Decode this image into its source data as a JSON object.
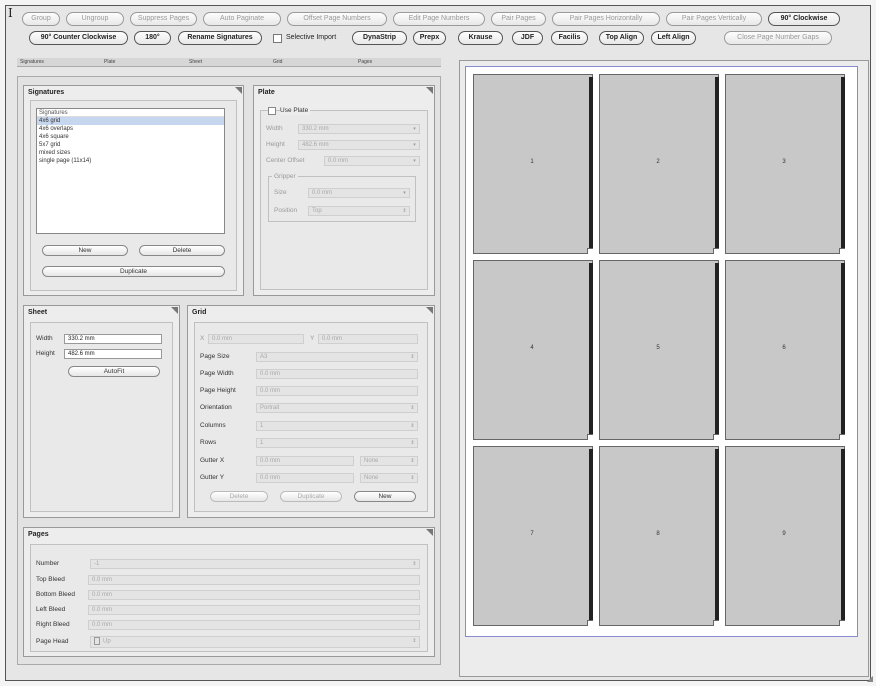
{
  "toolbar": {
    "row1": [
      {
        "label": "Group",
        "enabled": false
      },
      {
        "label": "Ungroup",
        "enabled": false
      },
      {
        "label": "Suppress Pages",
        "enabled": false
      },
      {
        "label": "Auto Paginate",
        "enabled": false
      },
      {
        "label": "Offset Page Numbers",
        "enabled": false
      },
      {
        "label": "Edit Page Numbers",
        "enabled": false
      },
      {
        "label": "Pair Pages",
        "enabled": false
      },
      {
        "label": "Pair Pages Horizontally",
        "enabled": false
      },
      {
        "label": "Pair Pages Vertically",
        "enabled": false
      },
      {
        "label": "90° Clockwise",
        "enabled": true
      }
    ],
    "row2": [
      {
        "label": "90° Counter Clockwise",
        "enabled": true
      },
      {
        "label": "180°",
        "enabled": true
      },
      {
        "label": "Rename Signatures",
        "enabled": true
      },
      {
        "label": "DynaStrip",
        "enabled": true
      },
      {
        "label": "Prepx",
        "enabled": true
      },
      {
        "label": "Krause",
        "enabled": true
      },
      {
        "label": "JDF",
        "enabled": true
      },
      {
        "label": "Facilis",
        "enabled": true
      },
      {
        "label": "Top Align",
        "enabled": true
      },
      {
        "label": "Left Align",
        "enabled": true
      },
      {
        "label": "Close Page Number Gaps",
        "enabled": false
      }
    ],
    "selective_import": "Selective Import"
  },
  "columns": [
    "Signatures",
    "Plate",
    "Sheet",
    "Grid",
    "Pages"
  ],
  "signatures": {
    "title": "Signatures",
    "list_header": "Signatures",
    "items": [
      "4x6 grid",
      "4x6 overlaps",
      "4x6 square",
      "5x7 grid",
      "mixed sizes",
      "single page (11x14)"
    ],
    "selected_index": 0,
    "new": "New",
    "delete": "Delete",
    "duplicate": "Duplicate"
  },
  "plate": {
    "title": "Plate",
    "use_plate": "Use Plate",
    "width_label": "Width",
    "width_value": "330.2 mm",
    "height_label": "Height",
    "height_value": "482.6 mm",
    "center_offset_label": "Center Offset",
    "center_offset_value": "0.0 mm",
    "gripper_title": "Gripper",
    "size_label": "Size",
    "size_value": "0.0 mm",
    "position_label": "Position",
    "position_value": "Top"
  },
  "sheet": {
    "title": "Sheet",
    "width_label": "Width",
    "width_value": "330.2 mm",
    "height_label": "Height",
    "height_value": "482.6 mm",
    "autofit": "AutoFit"
  },
  "grid": {
    "title": "Grid",
    "x_label": "X",
    "x_value": "0.0 mm",
    "y_label": "Y",
    "y_value": "0.0 mm",
    "page_size_label": "Page Size",
    "page_size_value": "A3",
    "page_width_label": "Page Width",
    "page_width_value": "0.0 mm",
    "page_height_label": "Page Height",
    "page_height_value": "0.0 mm",
    "orientation_label": "Orientation",
    "orientation_value": "Portrait",
    "columns_label": "Columns",
    "columns_value": "1",
    "rows_label": "Rows",
    "rows_value": "1",
    "gutter_x_label": "Gutter X",
    "gutter_x_value": "0.0 mm",
    "gutter_x_mode": "None",
    "gutter_y_label": "Gutter Y",
    "gutter_y_value": "0.0 mm",
    "gutter_y_mode": "None",
    "delete": "Delete",
    "duplicate": "Duplicate",
    "new": "New"
  },
  "pages": {
    "title": "Pages",
    "number_label": "Number",
    "number_value": "-1",
    "top_bleed_label": "Top Bleed",
    "top_bleed_value": "0.0 mm",
    "bottom_bleed_label": "Bottom Bleed",
    "bottom_bleed_value": "0.0 mm",
    "left_bleed_label": "Left Bleed",
    "left_bleed_value": "0.0 mm",
    "right_bleed_label": "Right Bleed",
    "right_bleed_value": "0.0 mm",
    "page_head_label": "Page Head",
    "page_head_value": "Up"
  },
  "preview": {
    "pages": [
      "1",
      "2",
      "3",
      "4",
      "5",
      "6",
      "7",
      "8",
      "9"
    ]
  }
}
